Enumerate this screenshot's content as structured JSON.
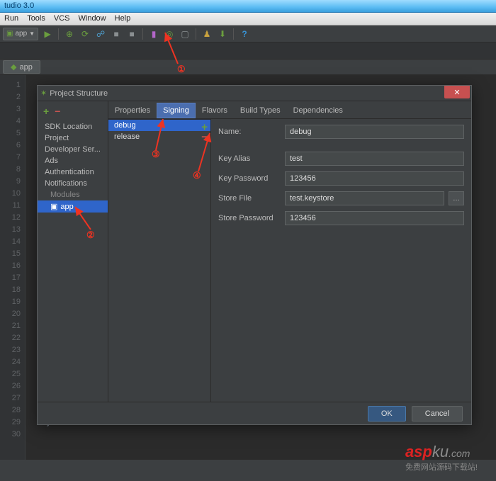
{
  "window": {
    "title": "tudio 3.0"
  },
  "menu": [
    "Run",
    "Tools",
    "VCS",
    "Window",
    "Help"
  ],
  "toolbar": {
    "combo": "app"
  },
  "filetab": {
    "label": "app"
  },
  "gutter_lines": 30,
  "dialog": {
    "title": "Project Structure",
    "close": "✕",
    "sidebar": {
      "items": [
        "SDK Location",
        "Project",
        "Developer Ser...",
        "Ads",
        "Authentication",
        "Notifications"
      ],
      "modules_label": "Modules",
      "module": "app"
    },
    "tabs": [
      "Properties",
      "Signing",
      "Flavors",
      "Build Types",
      "Dependencies"
    ],
    "active_tab": 1,
    "configs": [
      "debug",
      "release"
    ],
    "selected_config": 0,
    "form": {
      "name_label": "Name:",
      "name": "debug",
      "key_alias_label": "Key Alias",
      "key_alias": "test",
      "key_password_label": "Key Password",
      "key_password": "123456",
      "store_file_label": "Store File",
      "store_file": "test.keystore",
      "store_password_label": "Store Password",
      "store_password": "123456"
    },
    "buttons": {
      "ok": "OK",
      "cancel": "Cancel"
    }
  },
  "annotations": {
    "a1": "①",
    "a2": "②",
    "a3": "③",
    "a4": "④"
  },
  "watermark": {
    "brand1": "asp",
    "brand2": "ku",
    "suffix": ".com",
    "tagline": "免费网站源码下载站!"
  }
}
